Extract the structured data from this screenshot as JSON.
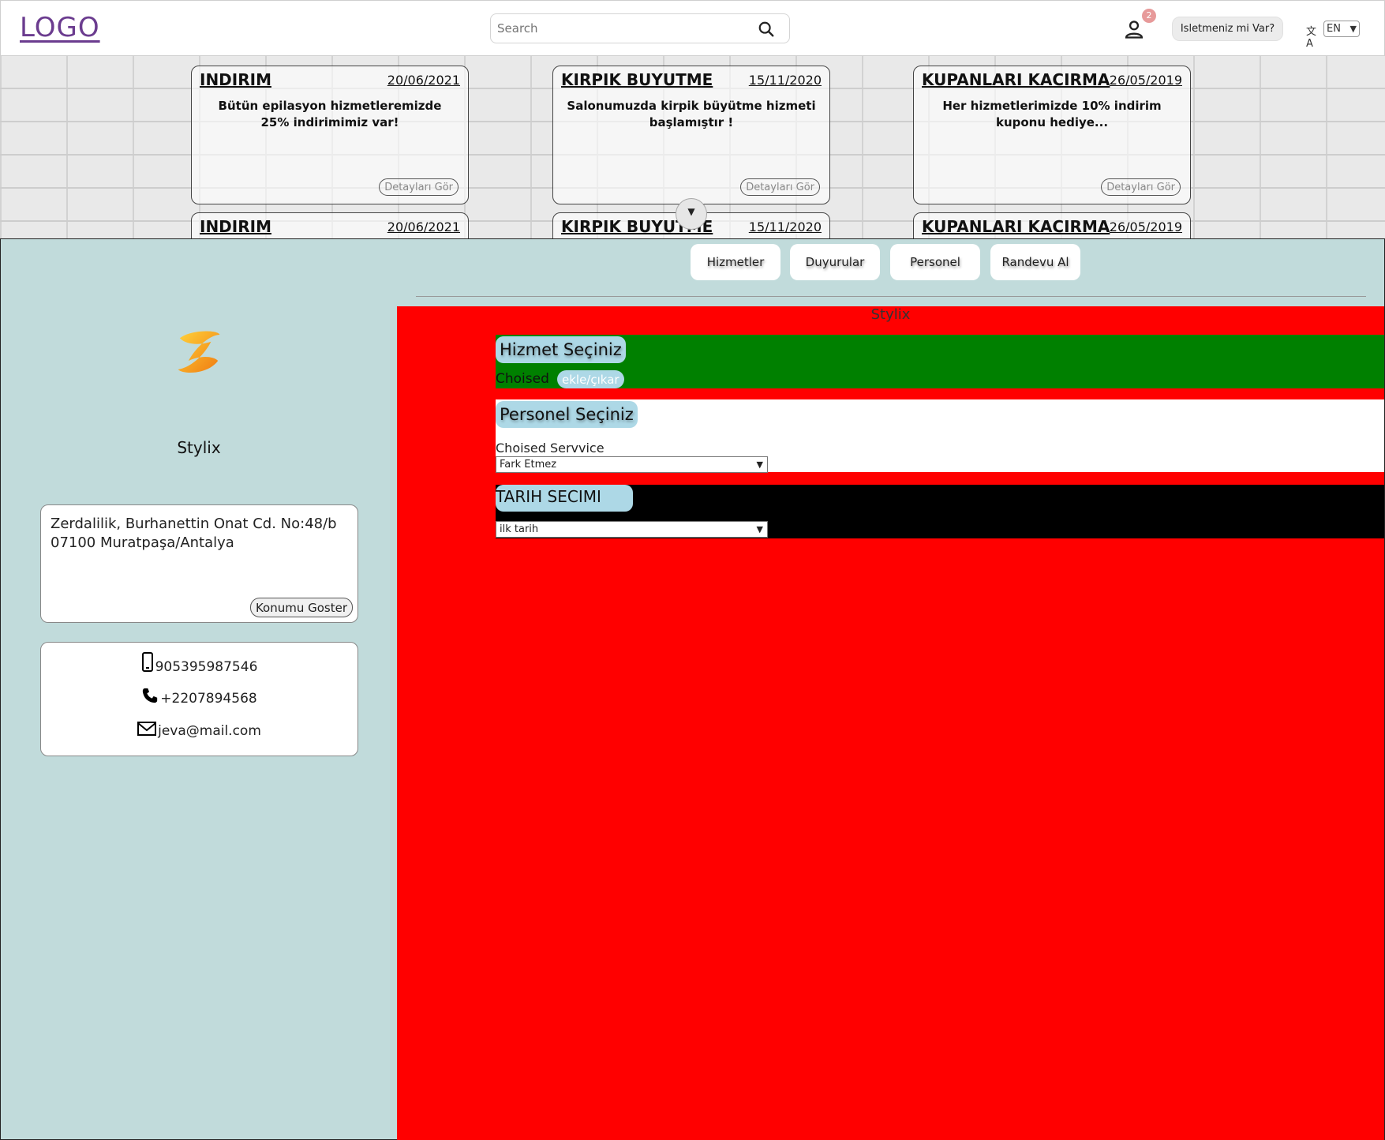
{
  "header": {
    "logo": "LOGO",
    "search_placeholder": "Search",
    "notification_count": "2",
    "business_button": "Isletmeniz mi Var?",
    "language": "EN"
  },
  "announcements": [
    {
      "title": "INDIRIM",
      "date": "20/06/2021",
      "body": "Bütün epilasyon hizmetleremizde 25% indirimimiz var!",
      "button": "Detayları Gör"
    },
    {
      "title": "KIRPIK BUYUTME",
      "date": "15/11/2020",
      "body": "Salonumuzda kirpik büyütme hizmeti başlamıştır !",
      "button": "Detayları Gör"
    },
    {
      "title": "KUPANLARI KACIRMA",
      "date": "26/05/2019",
      "body": "Her hizmetlerimizde 10% indirim kuponu hediye...",
      "button": "Detayları Gör"
    }
  ],
  "tabs": [
    "Hizmetler",
    "Duyurular",
    "Personel",
    "Randevu Al"
  ],
  "salon": {
    "name": "Stylix",
    "address": "Zerdalilik, Burhanettin Onat Cd. No:48/b 07100 Muratpaşa/Antalya",
    "location_button": "Konumu Goster",
    "mobile": "905395987546",
    "phone": "+2207894568",
    "email": "jeva@mail.com"
  },
  "booking": {
    "title": "Stylix",
    "service_heading": "Hizmet Seçiniz",
    "choised_label": "Choised",
    "add_remove_button": "ekle/çıkar",
    "staff_heading": "Personel Seçiniz",
    "choised_service_label": "Choised Servvice",
    "staff_select_value": "Fark Etmez",
    "date_heading": "TARIH SECIMI",
    "date_select_value": "ilk tarih"
  },
  "colors": {
    "logo": "#6b3c8f",
    "main_bg": "#c1dbdb",
    "panel_bg": "#ff0000",
    "service_section": "#008000",
    "date_section": "#000000",
    "pill": "#add8e6"
  }
}
